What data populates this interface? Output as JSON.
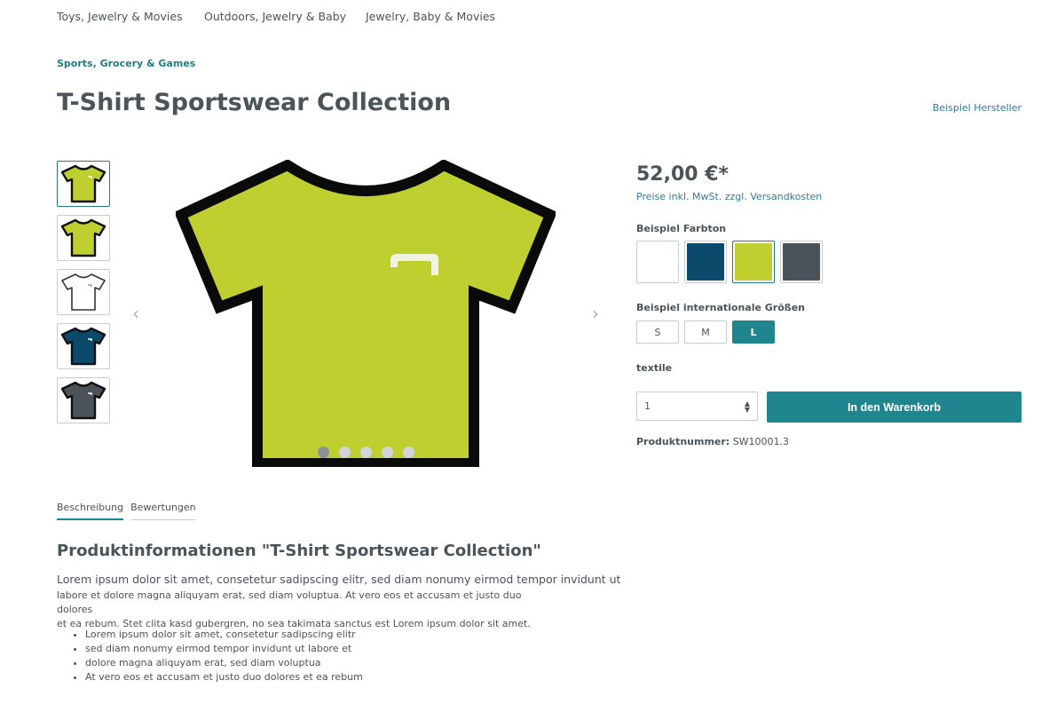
{
  "nav": {
    "items": [
      "Toys, Jewelry & Movies",
      "Outdoors, Jewelry & Baby",
      "Jewelry, Baby & Movies"
    ]
  },
  "breadcrumb": "Sports, Grocery & Games",
  "product": {
    "title": "T-Shirt Sportswear Collection",
    "manufacturer": "Beispiel Hersteller",
    "price": "52,00 €*",
    "tax_note": "Preise inkl. MwSt. zzgl. Versandkosten",
    "color_label": "Beispiel Farbton",
    "colors": [
      "#ffffff",
      "#0c4a6b",
      "#bfcf30",
      "#4a525a"
    ],
    "selected_color_index": 2,
    "size_label": "Beispiel internationale Größen",
    "sizes": [
      "S",
      "M",
      "L"
    ],
    "selected_size": "L",
    "textile_label": "textile",
    "quantity": "1",
    "add_to_cart": "In den Warenkorb",
    "product_number_label": "Produktnummer:",
    "product_number": "SW10001.3"
  },
  "gallery": {
    "thumb_colors": [
      "#bfcf30",
      "#bfcf30",
      "#ffffff",
      "#0c4a6b",
      "#4a525a"
    ],
    "main_color": "#bfcf30",
    "active_dot": 0,
    "dot_count": 5
  },
  "tabs": [
    "Beschreibung",
    "Bewertungen"
  ],
  "description": {
    "title": "Produktinformationen \"T-Shirt Sportswear Collection\"",
    "lead": "Lorem ipsum dolor sit amet, consetetur sadipscing elitr, sed diam nonumy eirmod tempor invidunt ut",
    "line1": "labore et dolore magna aliquyam erat, sed diam voluptua. At vero eos et accusam et justo duo dolores",
    "line2": "et ea rebum. Stet clita kasd gubergren, no sea takimata sanctus est Lorem ipsum dolor sit amet.",
    "bullets": [
      "Lorem ipsum dolor sit amet, consetetur sadipscing elitr",
      "sed diam nonumy eirmod tempor invidunt ut labore et",
      "dolore magna aliquyam erat, sed diam voluptua",
      "At vero eos et accusam et justo duo dolores et ea rebum"
    ]
  }
}
